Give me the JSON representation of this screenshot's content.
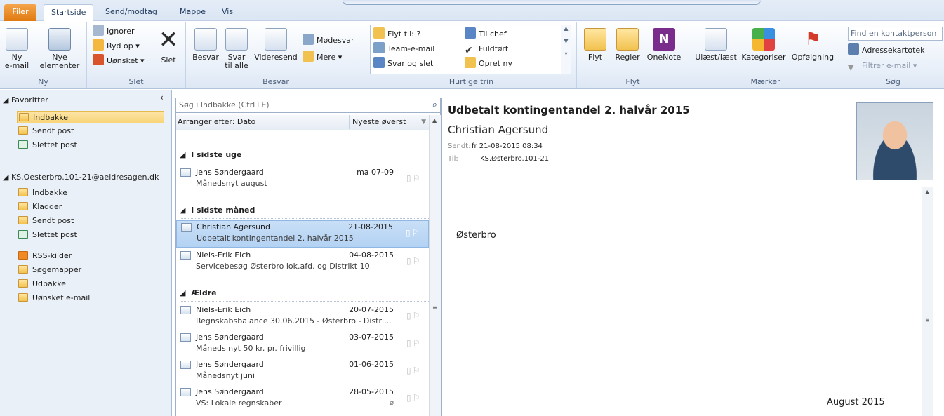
{
  "tabs": {
    "file": "Filer",
    "home": "Startside",
    "send": "Send/modtag",
    "folder": "Mappe",
    "view": "Vis"
  },
  "ribbon": {
    "new": {
      "new_email": "Ny\ne-mail",
      "new_items": "Nye\nelementer",
      "label": "Ny"
    },
    "delete": {
      "ignore": "Ignorer",
      "cleanup": "Ryd op",
      "junk": "Uønsket",
      "delete": "Slet",
      "label": "Slet"
    },
    "respond": {
      "reply": "Besvar",
      "reply_all": "Svar\ntil alle",
      "forward": "Videresend",
      "meeting": "Mødesvar",
      "more": "Mere",
      "label": "Besvar"
    },
    "quick": {
      "move_to": "Flyt til: ?",
      "team": "Team-e-mail",
      "reply_delete": "Svar og slet",
      "to_boss": "Til chef",
      "done": "Fuldført",
      "create_new": "Opret ny",
      "label": "Hurtige trin"
    },
    "move": {
      "move": "Flyt",
      "rules": "Regler",
      "onenote": "OneNote",
      "label": "Flyt"
    },
    "tags": {
      "unread": "Ulæst/læst",
      "categorize": "Kategoriser",
      "followup": "Opfølgning",
      "label": "Mærker"
    },
    "find": {
      "contact_placeholder": "Find en kontaktperson",
      "address_book": "Adressekartotek",
      "filter": "Filtrer e-mail",
      "label": "Søg"
    }
  },
  "nav": {
    "favorites_title": "Favoritter",
    "favorites": [
      "Indbakke",
      "Sendt post",
      "Slettet post"
    ],
    "account": "KS.Oesterbro.101-21@aeldresagen.dk",
    "folders": [
      "Indbakke",
      "Kladder",
      "Sendt post",
      "Slettet post"
    ],
    "extra": [
      "RSS-kilder",
      "Søgemapper",
      "Udbakke",
      "Uønsket e-mail"
    ]
  },
  "list": {
    "search_placeholder": "Søg i Indbakke (Ctrl+E)",
    "arrange": "Arranger efter: Dato",
    "order": "Nyeste øverst",
    "group_week": "I sidste uge",
    "group_month": "I sidste måned",
    "group_older": "Ældre",
    "mails": [
      {
        "from": "Jens Søndergaard",
        "date": "ma 07-09",
        "subject": "Månedsnyt august"
      },
      {
        "from": "Christian Agersund",
        "date": "21-08-2015",
        "subject": "Udbetalt kontingentandel 2. halvår 2015"
      },
      {
        "from": "Niels-Erik Eich",
        "date": "04-08-2015",
        "subject": "Servicebesøg Østerbro lok.afd. og Distrikt 10"
      },
      {
        "from": "Niels-Erik Eich",
        "date": "20-07-2015",
        "subject": "Regnskabsbalance 30.06.2015 - Østerbro - Distri..."
      },
      {
        "from": "Jens Søndergaard",
        "date": "03-07-2015",
        "subject": "Måneds nyt 50 kr. pr. frivillig"
      },
      {
        "from": "Jens Søndergaard",
        "date": "01-06-2015",
        "subject": "Månedsnyt juni"
      },
      {
        "from": "Jens Søndergaard",
        "date": "28-05-2015",
        "subject": "VS: Lokale regnskaber"
      }
    ]
  },
  "reading": {
    "subject": "Udbetalt kontingentandel 2. halvår 2015",
    "from": "Christian Agersund",
    "sent_label": "Sendt:",
    "sent": "fr 21-08-2015 08:34",
    "to_label": "Til:",
    "to": "KS.Østerbro.101-21",
    "body_line1": "Østerbro",
    "body_line2": "August 2015"
  }
}
